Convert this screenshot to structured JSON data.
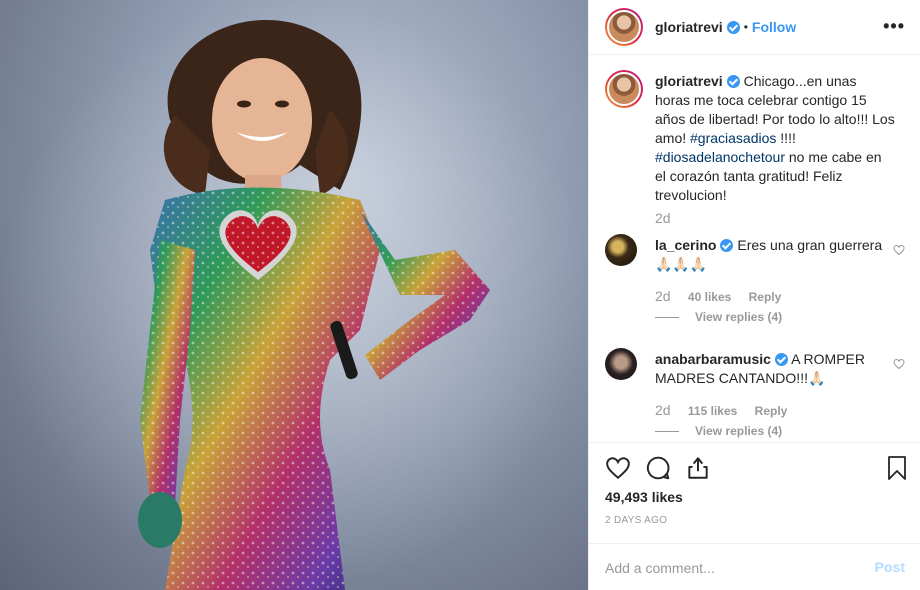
{
  "post": {
    "username": "gloriatrevi",
    "follow_label": "Follow",
    "dot": "•",
    "more_label": "•••"
  },
  "caption": {
    "username": "gloriatrevi",
    "text_1": "Chicago...en unas horas me toca celebrar contigo 15 años de libertad! Por todo lo alto!!! Los amo!",
    "hashtag_1": "#graciasadios",
    "text_2": " !!!! ",
    "hashtag_2": "#diosadelanochetour",
    "text_3": " no me cabe en el corazón tanta gratitud! Feliz trevolucion!",
    "time": "2d"
  },
  "comments": [
    {
      "username": "la_cerino",
      "text": "Eres una gran guerrera 🙏🏻🙏🏻🙏🏻",
      "time": "2d",
      "likes": "40 likes",
      "reply": "Reply",
      "view_replies": "View replies (4)"
    },
    {
      "username": "anabarbaramusic",
      "text": "A ROMPER MADRES CANTANDO!!!🙏🏻",
      "time": "2d",
      "likes": "115 likes",
      "reply": "Reply",
      "view_replies": "View replies (4)"
    }
  ],
  "footer": {
    "likes": "49,493 likes",
    "ago": "2 DAYS AGO",
    "comment_placeholder": "Add a comment...",
    "post_label": "Post"
  },
  "icons": [
    "heart-icon",
    "comment-icon",
    "share-icon",
    "bookmark-icon",
    "verified-badge-icon",
    "more-options-icon"
  ],
  "colors": {
    "link": "#3897f0",
    "hashtag": "#003569",
    "muted": "#999999",
    "post_disabled": "#b3dbff"
  }
}
